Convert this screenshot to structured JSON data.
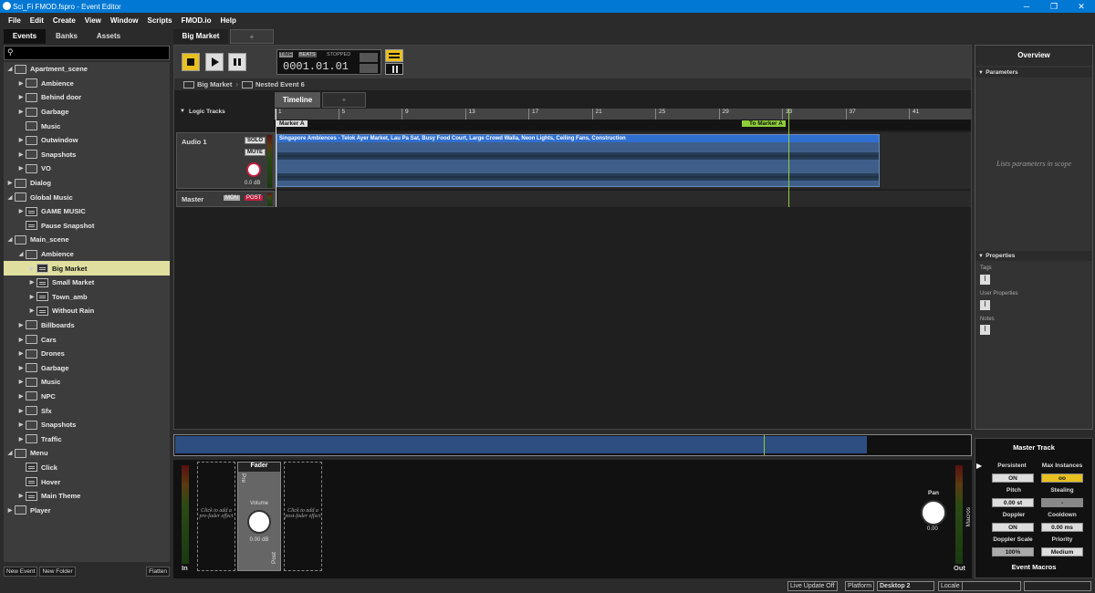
{
  "window": {
    "title": "Sci_Fi FMOD.fspro - Event Editor",
    "controls": [
      "─",
      "❐",
      "✕"
    ]
  },
  "menu": [
    "File",
    "Edit",
    "Create",
    "View",
    "Window",
    "Scripts",
    "FMOD.io",
    "Help"
  ],
  "left_tabs": [
    "Events",
    "Banks",
    "Assets"
  ],
  "tree": [
    {
      "label": "Apartment_scene",
      "level": 0,
      "type": "folder",
      "expanded": true
    },
    {
      "label": "Ambience",
      "level": 1,
      "type": "folder"
    },
    {
      "label": "Behind door",
      "level": 1,
      "type": "folder"
    },
    {
      "label": "Garbage",
      "level": 1,
      "type": "folder"
    },
    {
      "label": "Music",
      "level": 1,
      "type": "folder",
      "noarrow": true
    },
    {
      "label": "Outwindow",
      "level": 1,
      "type": "folder"
    },
    {
      "label": "Snapshots",
      "level": 1,
      "type": "folder"
    },
    {
      "label": "VO",
      "level": 1,
      "type": "folder"
    },
    {
      "label": "Dialog",
      "level": 0,
      "type": "folder"
    },
    {
      "label": "Global Music",
      "level": 0,
      "type": "folder",
      "expanded": true
    },
    {
      "label": "GAME MUSIC",
      "level": 1,
      "type": "event"
    },
    {
      "label": "Pause Snapshot",
      "level": 1,
      "type": "event",
      "noarrow": true
    },
    {
      "label": "Main_scene",
      "level": 0,
      "type": "folder",
      "expanded": true
    },
    {
      "label": "Ambience",
      "level": 1,
      "type": "folder",
      "expanded": true
    },
    {
      "label": "Big Market",
      "level": 2,
      "type": "event",
      "selected": true
    },
    {
      "label": "Small Market",
      "level": 2,
      "type": "event"
    },
    {
      "label": "Town_amb",
      "level": 2,
      "type": "event"
    },
    {
      "label": "Without Rain",
      "level": 2,
      "type": "event"
    },
    {
      "label": "Billboards",
      "level": 1,
      "type": "folder"
    },
    {
      "label": "Cars",
      "level": 1,
      "type": "folder"
    },
    {
      "label": "Drones",
      "level": 1,
      "type": "folder"
    },
    {
      "label": "Garbage",
      "level": 1,
      "type": "folder"
    },
    {
      "label": "Music",
      "level": 1,
      "type": "folder"
    },
    {
      "label": "NPC",
      "level": 1,
      "type": "folder"
    },
    {
      "label": "Sfx",
      "level": 1,
      "type": "folder"
    },
    {
      "label": "Snapshots",
      "level": 1,
      "type": "folder"
    },
    {
      "label": "Traffic",
      "level": 1,
      "type": "folder"
    },
    {
      "label": "Menu",
      "level": 0,
      "type": "folder",
      "expanded": true
    },
    {
      "label": "Click",
      "level": 1,
      "type": "event",
      "noarrow": true
    },
    {
      "label": "Hover",
      "level": 1,
      "type": "event",
      "noarrow": true
    },
    {
      "label": "Main Theme",
      "level": 1,
      "type": "event"
    },
    {
      "label": "Player",
      "level": 0,
      "type": "folder"
    }
  ],
  "left_buttons": {
    "new_event": "New Event",
    "new_folder": "New Folder",
    "flatten": "Flatten"
  },
  "doc_tabs": {
    "active": "Big Market",
    "add": "+"
  },
  "transport": {
    "time_label": "TIME",
    "beats_label": "BEATS",
    "state": "STOPPED",
    "position": "0001.01.01"
  },
  "breadcrumb": {
    "event": "Big Market",
    "nested": "Nested Event 6"
  },
  "timeline_tabs": {
    "active": "Timeline",
    "add": "+"
  },
  "logic_tracks": "Logic Tracks",
  "ruler_ticks": [
    "1",
    "5",
    "9",
    "13",
    "17",
    "21",
    "25",
    "29",
    "33",
    "37",
    "41"
  ],
  "markers": {
    "marker_a": "Marker A",
    "to_marker": "To Marker A"
  },
  "track": {
    "name": "Audio 1",
    "solo": "SOLO",
    "mute": "MUTE",
    "volume": "0.0 dB",
    "clip_title": "Singapore Ambiences - Telok Ayer Market, Lau Pa Sat, Busy Food Court, Large Crowd Walla, Neon Lights, Ceiling Fans, Construction"
  },
  "master_track": {
    "name": "Master",
    "mon": "MON",
    "post": "POST"
  },
  "overview": {
    "title": "Overview",
    "parameters": "Parameters",
    "params_hint": "Lists parameters in scope",
    "properties": "Properties",
    "tags": "Tags",
    "user_properties": "User Properties",
    "notes": "Notes"
  },
  "mixer": {
    "fader": "Fader",
    "pre": "Pre",
    "post": "Post",
    "volume": "Volume",
    "volume_value": "0.00 dB",
    "pre_effect": "Click to add a pre-fader effect",
    "post_effect": "Click to add a post-fader effect",
    "in": "In",
    "out": "Out",
    "pan": "Pan",
    "pan_value": "0.00",
    "macros": "Macros"
  },
  "master_panel": {
    "title": "Master Track",
    "persistent": "Persistent",
    "persistent_val": "ON",
    "max_instances": "Max Instances",
    "max_instances_val": "oo",
    "pitch": "Pitch",
    "pitch_val": "0.00 st",
    "stealing": "Stealing",
    "stealing_val": "-",
    "doppler": "Doppler",
    "doppler_val": "ON",
    "cooldown": "Cooldown",
    "cooldown_val": "0.00 ms",
    "doppler_scale": "Doppler Scale",
    "doppler_scale_val": "100%",
    "priority": "Priority",
    "priority_val": "Medium",
    "event_macros": "Event Macros"
  },
  "status": {
    "live_update": "Live Update Off",
    "platform": "Platform",
    "platform_val": "Desktop 2",
    "locale": "Locale"
  },
  "colors": {
    "accent": "#0078d4",
    "yellow": "#e8c020",
    "clip": "#3f5f8a",
    "selected": "#e0dfa0",
    "marker_green": "#8fce3a"
  }
}
